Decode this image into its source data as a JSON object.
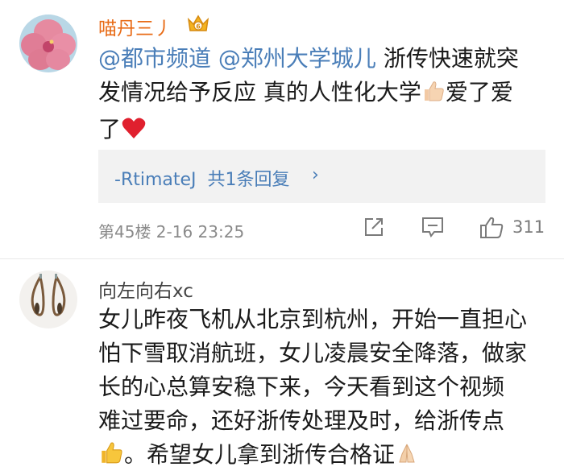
{
  "comments": [
    {
      "username": "喵丹三丿",
      "mention_1": "@都市频道",
      "mention_2": "@郑州大学城儿",
      "text_line1": "浙传快速就突",
      "text_line2": "发情况给予反应 真的人性化大学",
      "text_line2b": "爱了爱",
      "text_line3": "了",
      "reply_user": "-RtimateJ",
      "reply_count": "共1条回复",
      "reply_chevron": "›",
      "floor_meta": "第45楼 2-16 23:25",
      "like_count": "311",
      "icons": [
        "avatar-hibiscus",
        "vip-crown-icon",
        "thumbs-up-emoji",
        "red-heart-emoji",
        "share-icon",
        "comment-icon",
        "like-icon"
      ]
    },
    {
      "username": "向左向右xc",
      "line1": "女儿昨夜飞机从北京到杭州，开始一直担心",
      "line2": "怕下雪取消航班，女儿凌晨安全降落，做家",
      "line3": "长的心总算安稳下来，今天看到这个视频",
      "line4": "难过要命，还好浙传处理及时，给浙传点",
      "line5": "。希望女儿拿到浙传合格证",
      "icons": [
        "avatar-earrings",
        "thumbs-up-emoji",
        "praying-hands-emoji"
      ]
    }
  ],
  "colors": {
    "link": "#4a7eb8",
    "vip_name": "#e86b16",
    "meta": "#8a8a8a",
    "reply_bg": "#f2f2f2"
  }
}
